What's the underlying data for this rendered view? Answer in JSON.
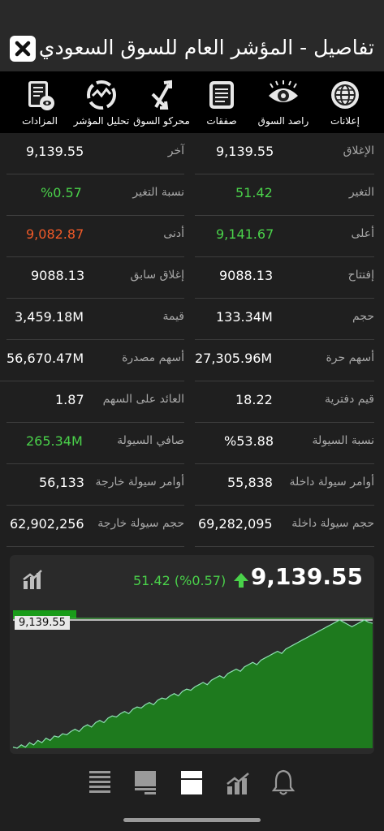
{
  "header": {
    "title": "تفاصيل - المؤشر العام للسوق السعودي"
  },
  "toolbar": {
    "items": [
      {
        "label": "إعلانات",
        "icon": "globe-icon"
      },
      {
        "label": "راصد السوق",
        "icon": "eye-icon"
      },
      {
        "label": "صفقات",
        "icon": "document-list-icon"
      },
      {
        "label": "محركو السوق",
        "icon": "arrows-icon"
      },
      {
        "label": "تحليل المؤشر",
        "icon": "analysis-wheel-icon"
      },
      {
        "label": "المزادات",
        "icon": "auction-document-icon"
      }
    ]
  },
  "stats": {
    "right": [
      {
        "label": "الإغلاق",
        "value": "9,139.55"
      },
      {
        "label": "التغير",
        "value": "51.42",
        "color": "#4ad24a"
      },
      {
        "label": "أعلى",
        "value": "9,141.67",
        "color": "#4ad24a"
      },
      {
        "label": "إفتتاح",
        "value": "9088.13"
      },
      {
        "label": "حجم",
        "value": "133.34M"
      },
      {
        "label": "أسهم حرة",
        "value": "27,305.96M"
      },
      {
        "label": "قيم دفترية",
        "value": "18.22"
      },
      {
        "label": "نسبة السيولة",
        "value": "%53.88"
      },
      {
        "label": "أوامر سيولة داخلة",
        "value": "55,838"
      },
      {
        "label": "حجم سيولة داخلة",
        "value": "69,282,095"
      }
    ],
    "left": [
      {
        "label": "آخر",
        "value": "9,139.55"
      },
      {
        "label": "نسبة التغير",
        "value": "%0.57",
        "color": "#4ad24a"
      },
      {
        "label": "أدنى",
        "value": "9,082.87",
        "color": "#f05a28"
      },
      {
        "label": "إغلاق سابق",
        "value": "9088.13"
      },
      {
        "label": "قيمة",
        "value": "3,459.18M"
      },
      {
        "label": "أسهم مصدرة",
        "value": "56,670.47M"
      },
      {
        "label": "العائد على السهم",
        "value": "1.87"
      },
      {
        "label": "صافي السيولة",
        "value": "265.34M",
        "color": "#4ad24a"
      },
      {
        "label": "أوامر سيولة خارجة",
        "value": "56,133"
      },
      {
        "label": "حجم سيولة خارجة",
        "value": "62,902,256"
      }
    ]
  },
  "chart_card": {
    "price": "9,139.55",
    "change": "51.42 (%0.57)",
    "direction_icon": "up-arrow-icon",
    "last_price_tag": "9,139.55"
  },
  "chart_data": {
    "type": "area",
    "series": [
      {
        "values": [
          9084,
          9083.5,
          9085,
          9084,
          9086,
          9085,
          9087,
          9086,
          9088,
          9087,
          9089,
          9088.5,
          9090,
          9089.5,
          9091,
          9092,
          9091,
          9093,
          9094,
          9093,
          9095,
          9096,
          9095,
          9097,
          9098,
          9097.5,
          9099,
          9100,
          9099,
          9101,
          9102,
          9101.5,
          9103,
          9104,
          9103,
          9105,
          9106,
          9105.5,
          9107,
          9108,
          9107,
          9109,
          9110,
          9109.5,
          9111,
          9112,
          9113,
          9112,
          9114,
          9115,
          9116,
          9115,
          9117,
          9118,
          9119,
          9118,
          9120,
          9121,
          9122,
          9121,
          9123,
          9124,
          9125,
          9126,
          9127,
          9126,
          9128,
          9129,
          9130,
          9131,
          9132,
          9133,
          9134,
          9135,
          9136,
          9137,
          9138,
          9139,
          9140,
          9141,
          9140,
          9139,
          9138,
          9139,
          9140,
          9141,
          9140,
          9139.55
        ]
      }
    ],
    "last_value": 9139.55,
    "colors": {
      "fill": "#1e7a1e",
      "line": "#4ad24a"
    }
  },
  "bottom_nav": {
    "items": [
      {
        "icon": "list-icon"
      },
      {
        "icon": "summary-icon"
      },
      {
        "icon": "details-icon"
      },
      {
        "icon": "chart-icon"
      },
      {
        "icon": "bell-icon"
      }
    ]
  }
}
